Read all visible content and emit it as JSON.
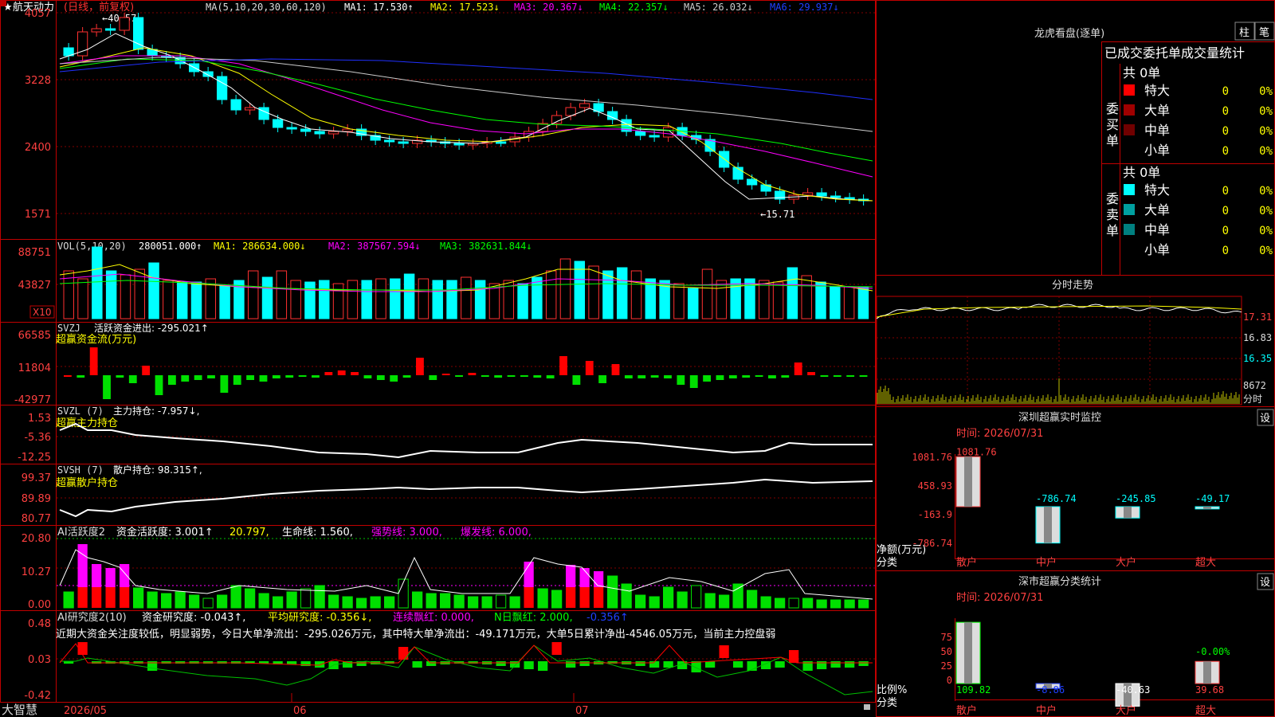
{
  "app": {
    "name": "大智慧"
  },
  "stock": {
    "name": "航天动力",
    "period": "(日线，前复权)",
    "star": "★"
  },
  "ma_header": {
    "label": "MA(5,10,20,30,60,120)",
    "ma1": "MA1: 17.530↑",
    "ma2": "MA2: 17.523↓",
    "ma3": "MA3: 20.367↓",
    "ma4": "MA4: 22.357↓",
    "ma5": "MA5: 26.032↓",
    "ma6": "MA6: 29.937↓"
  },
  "price_panel": {
    "yticks": [
      "4057",
      "3228",
      "2400",
      "1571"
    ],
    "high_label": "←40.57",
    "low_label": "←15.71"
  },
  "vol_panel": {
    "label": "VOL(5,10,20)",
    "value": "280051.000↑",
    "ma1": "MA1: 286634.000↓",
    "ma2": "MA2: 387567.594↓",
    "ma3": "MA3: 382631.844↓",
    "yticks": [
      "88751",
      "43827"
    ],
    "unit": "X10"
  },
  "svzj_panel": {
    "label": "SVZJ",
    "name": "活跃资金进出: -295.021↑",
    "subtitle": "超赢资金流(万元)",
    "yticks": [
      "66585",
      "11804",
      "-42977"
    ]
  },
  "svzl_panel": {
    "label": "SVZL (7)",
    "name": "主力持仓: -7.957↓,",
    "subtitle": "超赢主力持仓",
    "yticks": [
      "1.53",
      "-5.36",
      "-12.25"
    ]
  },
  "svsh_panel": {
    "label": "SVSH (7)",
    "name": "散户持仓: 98.315↑,",
    "subtitle": "超赢散户持仓",
    "yticks": [
      "99.37",
      "89.89",
      "80.77"
    ]
  },
  "ai1_panel": {
    "label": "AI活跃度2",
    "a": "资金活跃度: 3.001↑",
    "b": "20.797,",
    "c": "生命线: 1.560,",
    "d": "强势线: 3.000,",
    "e": "爆发线: 6.000,",
    "yticks": [
      "20.80",
      "10.27",
      "0.00"
    ]
  },
  "ai2_panel": {
    "label": "AI研究度2(10)",
    "a": "资金研究度: -0.043↑,",
    "b": "平均研究度: -0.356↓,",
    "c": "连续飘红: 0.000,",
    "d": "N日飘红: 2.000,",
    "e": "-0.356↑",
    "comment": "近期大资金关注度较低，明显弱势，今日大单净流出：-295.026万元，其中特大单净流出：-49.171万元，大单5日累计净出-4546.05万元，当前主力控盘弱",
    "yticks": [
      "0.48",
      "0.03",
      "-0.42"
    ]
  },
  "date_axis": {
    "labels": [
      "2026/05",
      "06",
      "07"
    ]
  },
  "longhu": {
    "title": "龙虎看盘(逐单)",
    "btn1": "柱",
    "btn2": "笔",
    "header": "已成交委托单成交量统计",
    "buy_label": "委买单",
    "sell_label": "委卖单",
    "buy": {
      "total": "共 0单",
      "rows": [
        {
          "name": "特大",
          "count": "0",
          "pct": "0%",
          "color": "#ff0000"
        },
        {
          "name": "大单",
          "count": "0",
          "pct": "0%",
          "color": "#a00000"
        },
        {
          "name": "中单",
          "count": "0",
          "pct": "0%",
          "color": "#700000"
        },
        {
          "name": "小单",
          "count": "0",
          "pct": "0%",
          "color": "#000000"
        }
      ]
    },
    "sell": {
      "total": "共 0单",
      "rows": [
        {
          "name": "特大",
          "count": "0",
          "pct": "0%",
          "color": "#00ffff"
        },
        {
          "name": "大单",
          "count": "0",
          "pct": "0%",
          "color": "#00a0a0"
        },
        {
          "name": "中单",
          "count": "0",
          "pct": "0%",
          "color": "#008080"
        },
        {
          "name": "小单",
          "count": "0",
          "pct": "0%",
          "color": "#000000"
        }
      ]
    }
  },
  "fenshi": {
    "title": "分时走势",
    "yticks": [
      "17.31",
      "16.83",
      "16.35"
    ],
    "vol_label": "8672",
    "vol_unit": "分时"
  },
  "sz_monitor": {
    "title": "深圳超赢实时监控",
    "settings": "设",
    "time": "时间: 2026/07/31",
    "yticks": [
      "1081.76",
      "458.93",
      "-163.9",
      "-786.74"
    ],
    "ylabel": "净额(万元)",
    "xlabel": "分类",
    "chart_data": {
      "type": "bar",
      "categories": [
        "散户",
        "中户",
        "大户",
        "超大"
      ],
      "values": [
        1081.76,
        -786.74,
        -245.85,
        -49.17
      ],
      "value_labels": [
        "1081.76",
        "-786.74",
        "-245.85",
        "-49.17"
      ],
      "ylim": [
        -786.74,
        1081.76
      ]
    }
  },
  "sz_class": {
    "title": "深市超赢分类统计",
    "settings": "设",
    "time": "时间: 2026/07/31",
    "yticks": [
      "75",
      "50",
      "25",
      "0"
    ],
    "ylabel": "比例%",
    "xlabel": "分类",
    "peak_label": "-0.00%",
    "chart_data": {
      "type": "bar",
      "categories": [
        "散户",
        "中户",
        "大户",
        "超大"
      ],
      "values": [
        109.82,
        -8.86,
        -40.63,
        39.68
      ],
      "value_labels": [
        "109.82",
        "-8.86",
        "-40.63",
        "39.68"
      ],
      "ylim": [
        0,
        100
      ]
    }
  }
}
